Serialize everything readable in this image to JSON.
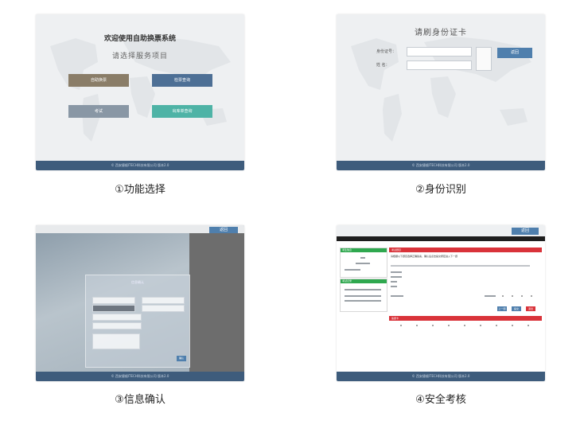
{
  "panels": [
    {
      "caption": "①功能选择",
      "title": "欢迎使用自助换票系统",
      "subtitle": "请选择服务项目",
      "buttons": [
        {
          "label": "自助换票",
          "color": "#8a7d68"
        },
        {
          "label": "检票查询",
          "color": "#4d6f95"
        },
        {
          "label": "考试",
          "color": "#8997a5"
        },
        {
          "label": "出库单查询",
          "color": "#4eb3a6"
        }
      ],
      "footer": "©  西安捷顺ITECH科技有限公司 版本2.0"
    },
    {
      "caption": "②身份识别",
      "title": "请刷身份证卡",
      "id_label": "身份证号：",
      "name_label": "姓    名：",
      "back_button": "返回",
      "footer": "©  西安捷顺ITECH科技有限公司 版本2.0"
    },
    {
      "caption": "③信息确认",
      "back_button": "返回",
      "dialog_title": "信息确认",
      "confirm_button": "确认",
      "footer": "©  西安捷顺ITECH科技有限公司 版本2.0"
    },
    {
      "caption": "④安全考核",
      "back_button": "返回",
      "side_heading_1": "考生信息",
      "side_heading_2": "考试记录",
      "question_heading": "考试题目",
      "question_text": "请根据以下题目选择正确答案，确认后点击提交按钮进入下一题",
      "answer_heading": "答题卡",
      "prev_button": "上一题",
      "next_button": "提交",
      "exit_button": "退出",
      "footer": "©  西安捷顺ITECH科技有限公司 版本2.0"
    }
  ],
  "colors": {
    "footer": "#3e5c7c",
    "back_button": "#4f7fad",
    "exam_red": "#d9333a",
    "exam_green": "#2fa84f"
  }
}
